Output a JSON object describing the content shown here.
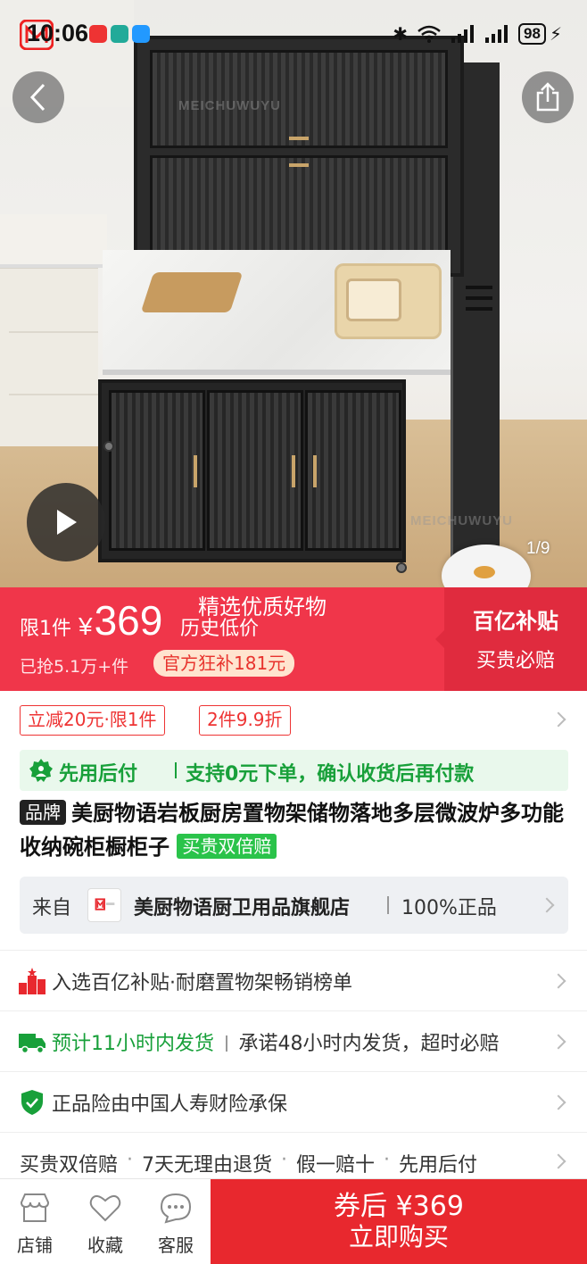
{
  "status_bar": {
    "time": "10:06",
    "battery": "98"
  },
  "gallery": {
    "counter": "1/9",
    "watermark": "MEICHUWUYU"
  },
  "price_banner": {
    "limit": "限1件",
    "currency": "¥",
    "price": "369",
    "slogan_top": "精选优质好物",
    "slogan_sub": "历史低价",
    "sold": "已抢5.1万+件",
    "subsidy": "官方狂补181元",
    "right_title": "百亿补贴",
    "right_sub": "买贵必赔"
  },
  "coupons": [
    "立减20元·限1件",
    "2件9.9折"
  ],
  "pay_later": {
    "title": "先用后付",
    "desc": "支持0元下单，确认收货后再付款"
  },
  "product": {
    "brand_tag": "品牌",
    "title": "美厨物语岩板厨房置物架储物落地多层微波炉多功能收纳碗柜橱柜子",
    "double_tag": "买贵双倍赔"
  },
  "store": {
    "from_label": "来自",
    "name": "美厨物语厨卫用品旗舰店",
    "auth": "100%正品"
  },
  "info_rows": {
    "ranking": "入选百亿补贴·耐磨置物架畅销榜单",
    "shipping_highlight": "预计11小时内发货",
    "shipping_desc": "承诺48小时内发货，超时必赔",
    "insurance": "正品险由中国人寿财险承保"
  },
  "services": [
    "买贵双倍赔",
    "7天无理由退货",
    "假一赔十",
    "先用后付"
  ],
  "bottom_bar": {
    "tabs": [
      "店铺",
      "收藏",
      "客服"
    ],
    "buy_line1": "券后 ¥369",
    "buy_line2": "立即购买"
  },
  "colors": {
    "brand_red": "#f0364a",
    "buy_red": "#e8282e",
    "green": "#18a03a"
  }
}
